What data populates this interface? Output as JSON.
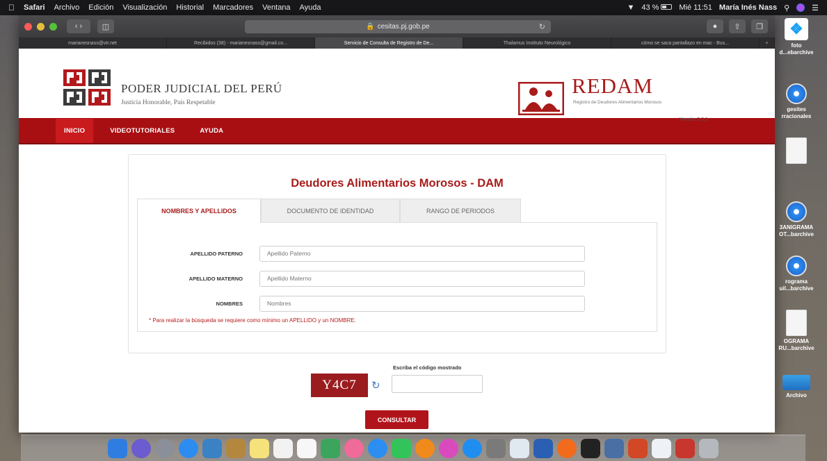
{
  "menubar": {
    "app": "Safari",
    "items": [
      "Archivo",
      "Edición",
      "Visualización",
      "Historial",
      "Marcadores",
      "Ventana",
      "Ayuda"
    ],
    "battery": "43 %",
    "clock": "Mié 11:51",
    "user": "María Inés Nass"
  },
  "browser": {
    "url": "cesitas.pj.gob.pe",
    "tabs": [
      {
        "label": "marianesnass@vtr.net",
        "active": false
      },
      {
        "label": "Recibidos (38) - marianesnass@gmail.co...",
        "active": false
      },
      {
        "label": "Servicio de Consulta de Registro de De...",
        "active": true
      },
      {
        "label": "Thalamus Instituto Neurológico",
        "active": false
      },
      {
        "label": "cómo se saca pantallazo en mac - Bus...",
        "active": false
      }
    ]
  },
  "header": {
    "pj_title": "PODER JUDICIAL DEL PERÚ",
    "pj_subtitle": "Justicia Honorable, País Respetable",
    "redam_title": "REDAM",
    "redam_subtitle": "Registro de Deudores Alimentarios Morosos",
    "version": "Versión 3.0.1"
  },
  "nav": {
    "items": [
      {
        "label": "INICIO",
        "active": true
      },
      {
        "label": "VIDEOTUTORIALES",
        "active": false
      },
      {
        "label": "AYUDA",
        "active": false
      }
    ]
  },
  "form": {
    "title": "Deudores Alimentarios Morosos - DAM",
    "tabs": [
      {
        "label": "NOMBRES Y APELLIDOS",
        "active": true
      },
      {
        "label": "DOCUMENTO DE IDENTIDAD",
        "active": false
      },
      {
        "label": "RANGO DE PERIODOS",
        "active": false
      }
    ],
    "fields": [
      {
        "label": "APELLIDO PATERNO",
        "placeholder": "Apellido Paterno",
        "value": ""
      },
      {
        "label": "APELLIDO MATERNO",
        "placeholder": "Apellido Materno",
        "value": ""
      },
      {
        "label": "NOMBRES",
        "placeholder": "Nombres",
        "value": ""
      }
    ],
    "note": "* Para realizar la búsqueda se requiere como mínimo un APELLIDO y un NOMBRE.",
    "captcha_text": "Y4C7",
    "code_label": "Escriba el código mostrado",
    "submit_label": "CONSULTAR"
  },
  "desktop_icons": [
    {
      "label": "foto\nd...ebarchive"
    },
    {
      "label": "gesites\nrracionales"
    },
    {
      "label": "3ANIGRAMA\nOT...barchive"
    },
    {
      "label": "rograma\nuil...barchive"
    },
    {
      "label": "OGRAMA\nRU...barchive"
    },
    {
      "label": "Archivo"
    }
  ],
  "colors": {
    "brand_red": "#a80f12",
    "title_red": "#a81b1b",
    "captcha_bg": "#9b1c1f"
  }
}
